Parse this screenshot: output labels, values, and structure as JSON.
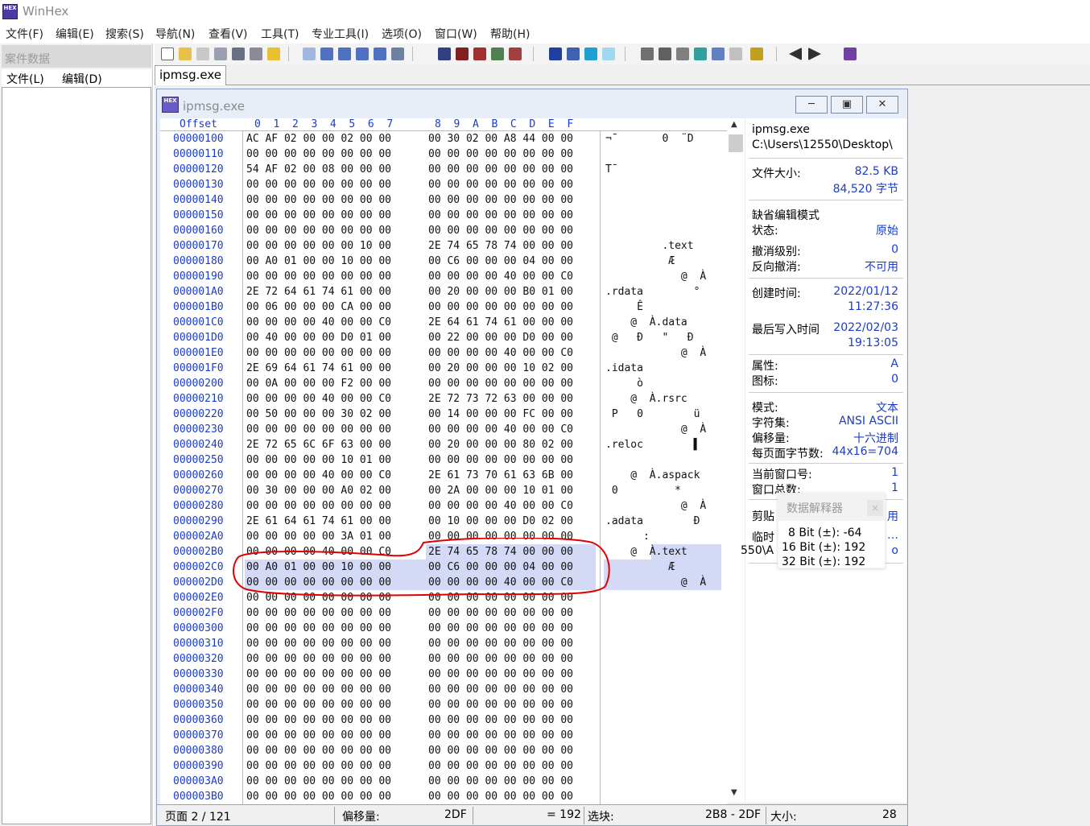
{
  "app": {
    "title": "WinHex"
  },
  "menu": [
    "文件(F)",
    "编辑(E)",
    "搜索(S)",
    "导航(N)",
    "查看(V)",
    "工具(T)",
    "专业工具(I)",
    "选项(O)",
    "窗口(W)",
    "帮助(H)"
  ],
  "case_panel": {
    "title": "案件数据",
    "menu": [
      "文件(L)",
      "编辑(D)"
    ]
  },
  "tab": {
    "label": "ipmsg.exe"
  },
  "doc": {
    "title": "ipmsg.exe",
    "buttons": [
      "minimize",
      "restore",
      "close"
    ]
  },
  "hex_header": "Offset      0  1  2  3  4  5  6  7   8  9  A  B  C  D  E  F",
  "rows": [
    {
      "off": "00000100",
      "a": "AC AF 02 00 00 02 00 00",
      "b": "00 30 02 00 A8 44 00 00",
      "asc": "¬¯       0  ¨D  "
    },
    {
      "off": "00000110",
      "a": "00 00 00 00 00 00 00 00",
      "b": "00 00 00 00 00 00 00 00",
      "asc": ""
    },
    {
      "off": "00000120",
      "a": "54 AF 02 00 08 00 00 00",
      "b": "00 00 00 00 00 00 00 00",
      "asc": "T¯"
    },
    {
      "off": "00000130",
      "a": "00 00 00 00 00 00 00 00",
      "b": "00 00 00 00 00 00 00 00",
      "asc": ""
    },
    {
      "off": "00000140",
      "a": "00 00 00 00 00 00 00 00",
      "b": "00 00 00 00 00 00 00 00",
      "asc": ""
    },
    {
      "off": "00000150",
      "a": "00 00 00 00 00 00 00 00",
      "b": "00 00 00 00 00 00 00 00",
      "asc": ""
    },
    {
      "off": "00000160",
      "a": "00 00 00 00 00 00 00 00",
      "b": "00 00 00 00 00 00 00 00",
      "asc": ""
    },
    {
      "off": "00000170",
      "a": "00 00 00 00 00 00 10 00",
      "b": "2E 74 65 78 74 00 00 00",
      "asc": "         .text   "
    },
    {
      "off": "00000180",
      "a": "00 A0 01 00 00 10 00 00",
      "b": "00 C6 00 00 00 04 00 00",
      "asc": "          Æ      "
    },
    {
      "off": "00000190",
      "a": "00 00 00 00 00 00 00 00",
      "b": "00 00 00 00 40 00 00 C0",
      "asc": "            @  À"
    },
    {
      "off": "000001A0",
      "a": "2E 72 64 61 74 61 00 00",
      "b": "00 20 00 00 00 B0 01 00",
      "asc": ".rdata        °  "
    },
    {
      "off": "000001B0",
      "a": "00 06 00 00 00 CA 00 00",
      "b": "00 00 00 00 00 00 00 00",
      "asc": "     Ê"
    },
    {
      "off": "000001C0",
      "a": "00 00 00 00 40 00 00 C0",
      "b": "2E 64 61 74 61 00 00 00",
      "asc": "    @  À.data"
    },
    {
      "off": "000001D0",
      "a": "00 40 00 00 00 D0 01 00",
      "b": "00 22 00 00 00 D0 00 00",
      "asc": " @   Ð   \"   Ð  "
    },
    {
      "off": "000001E0",
      "a": "00 00 00 00 00 00 00 00",
      "b": "00 00 00 00 40 00 00 C0",
      "asc": "            @  À"
    },
    {
      "off": "000001F0",
      "a": "2E 69 64 61 74 61 00 00",
      "b": "00 20 00 00 00 10 02 00",
      "asc": ".idata"
    },
    {
      "off": "00000200",
      "a": "00 0A 00 00 00 F2 00 00",
      "b": "00 00 00 00 00 00 00 00",
      "asc": "     ò"
    },
    {
      "off": "00000210",
      "a": "00 00 00 00 40 00 00 C0",
      "b": "2E 72 73 72 63 00 00 00",
      "asc": "    @  À.rsrc"
    },
    {
      "off": "00000220",
      "a": "00 50 00 00 00 30 02 00",
      "b": "00 14 00 00 00 FC 00 00",
      "asc": " P   0        ü  "
    },
    {
      "off": "00000230",
      "a": "00 00 00 00 00 00 00 00",
      "b": "00 00 00 00 40 00 00 C0",
      "asc": "            @  À"
    },
    {
      "off": "00000240",
      "a": "2E 72 65 6C 6F 63 00 00",
      "b": "00 20 00 00 00 80 02 00",
      "asc": ".reloc        ▌  "
    },
    {
      "off": "00000250",
      "a": "00 00 00 00 00 10 01 00",
      "b": "00 00 00 00 00 00 00 00",
      "asc": ""
    },
    {
      "off": "00000260",
      "a": "00 00 00 00 40 00 00 C0",
      "b": "2E 61 73 70 61 63 6B 00",
      "asc": "    @  À.aspack"
    },
    {
      "off": "00000270",
      "a": "00 30 00 00 00 A0 02 00",
      "b": "00 2A 00 00 00 10 01 00",
      "asc": " 0         *     "
    },
    {
      "off": "00000280",
      "a": "00 00 00 00 00 00 00 00",
      "b": "00 00 00 00 40 00 00 C0",
      "asc": "            @  À"
    },
    {
      "off": "00000290",
      "a": "2E 61 64 61 74 61 00 00",
      "b": "00 10 00 00 00 D0 02 00",
      "asc": ".adata        Ð  "
    },
    {
      "off": "000002A0",
      "a": "00 00 00 00 00 3A 01 00",
      "b": "00 00 00 00 00 00 00 00",
      "asc": "      :"
    },
    {
      "off": "000002B0",
      "a": "00 00 00 00 40 00 00 C0",
      "b": "2E 74 65 78 74 00 00 00",
      "asc": "    @  À.text",
      "hl": "partial"
    },
    {
      "off": "000002C0",
      "a": "00 A0 01 00 00 10 00 00",
      "b": "00 C6 00 00 00 04 00 00",
      "asc": "          Æ",
      "hl": "full"
    },
    {
      "off": "000002D0",
      "a": "00 00 00 00 00 00 00 00",
      "b": "00 00 00 00 40 00 00 C0",
      "asc": "            @  À",
      "hl": "full"
    },
    {
      "off": "000002E0",
      "a": "00 00 00 00 00 00 00 00",
      "b": "00 00 00 00 00 00 00 00",
      "asc": ""
    },
    {
      "off": "000002F0",
      "a": "00 00 00 00 00 00 00 00",
      "b": "00 00 00 00 00 00 00 00",
      "asc": ""
    },
    {
      "off": "00000300",
      "a": "00 00 00 00 00 00 00 00",
      "b": "00 00 00 00 00 00 00 00",
      "asc": ""
    },
    {
      "off": "00000310",
      "a": "00 00 00 00 00 00 00 00",
      "b": "00 00 00 00 00 00 00 00",
      "asc": ""
    },
    {
      "off": "00000320",
      "a": "00 00 00 00 00 00 00 00",
      "b": "00 00 00 00 00 00 00 00",
      "asc": ""
    },
    {
      "off": "00000330",
      "a": "00 00 00 00 00 00 00 00",
      "b": "00 00 00 00 00 00 00 00",
      "asc": ""
    },
    {
      "off": "00000340",
      "a": "00 00 00 00 00 00 00 00",
      "b": "00 00 00 00 00 00 00 00",
      "asc": ""
    },
    {
      "off": "00000350",
      "a": "00 00 00 00 00 00 00 00",
      "b": "00 00 00 00 00 00 00 00",
      "asc": ""
    },
    {
      "off": "00000360",
      "a": "00 00 00 00 00 00 00 00",
      "b": "00 00 00 00 00 00 00 00",
      "asc": ""
    },
    {
      "off": "00000370",
      "a": "00 00 00 00 00 00 00 00",
      "b": "00 00 00 00 00 00 00 00",
      "asc": ""
    },
    {
      "off": "00000380",
      "a": "00 00 00 00 00 00 00 00",
      "b": "00 00 00 00 00 00 00 00",
      "asc": ""
    },
    {
      "off": "00000390",
      "a": "00 00 00 00 00 00 00 00",
      "b": "00 00 00 00 00 00 00 00",
      "asc": ""
    },
    {
      "off": "000003A0",
      "a": "00 00 00 00 00 00 00 00",
      "b": "00 00 00 00 00 00 00 00",
      "asc": ""
    },
    {
      "off": "000003B0",
      "a": "00 00 00 00 00 00 00 00",
      "b": "00 00 00 00 00 00 00 00",
      "asc": ""
    }
  ],
  "info": {
    "filename": "ipmsg.exe",
    "path": "C:\\Users\\12550\\Desktop\\",
    "size_label": "文件大小:",
    "size_kb": "82.5 KB",
    "size_bytes": "84,520 字节",
    "edit_mode_label": "缺省编辑模式",
    "state_label": "状态:",
    "state_value": "原始",
    "undo_level_label": "撤消级别:",
    "undo_level_value": "0",
    "reverse_undo_label": "反向撤消:",
    "reverse_undo_value": "不可用",
    "created_label": "创建时间:",
    "created_date": "2022/01/12",
    "created_time": "11:27:36",
    "modified_label": "最后写入时间",
    "modified_date": "2022/02/03",
    "modified_time": "19:13:05",
    "attr_label": "属性:",
    "attr_value": "A",
    "icon_label": "图标:",
    "icon_value": "0",
    "mode_label": "模式:",
    "mode_value": "文本",
    "charset_label": "字符集:",
    "charset_value": "ANSI ASCII",
    "offset_label": "偏移量:",
    "offset_value": "十六进制",
    "bytes_per_page_label": "每页面字节数:",
    "bytes_per_page_value": "44x16=704",
    "cur_window_label": "当前窗口号:",
    "cur_window_value": "1",
    "window_total_label": "窗口总数:",
    "window_total_value": "1",
    "clipboard_label": "剪贴",
    "clipboard_tail": "用",
    "temp_label": "临时",
    "temp_tail": "…",
    "temp_path_fragment": "550\\A",
    "temp_path_tail": "o"
  },
  "interpreter": {
    "title": "数据解释器",
    "close": "×",
    "bit8": "8 Bit (±): -64",
    "bit16": "16 Bit (±): 192",
    "bit32": "32 Bit (±): 192"
  },
  "status": {
    "page": "页面 2 / 121",
    "offset_label": "偏移量:",
    "offset_value": "2DF",
    "value": "= 192",
    "block_label": "选块:",
    "block_value": "2B8 - 2DF",
    "size_label": "大小:",
    "size_value": "28"
  },
  "colors": {
    "offset_blue": "#1a3cc8",
    "highlight": "#d4daf6",
    "annotation_red": "#e00000"
  }
}
